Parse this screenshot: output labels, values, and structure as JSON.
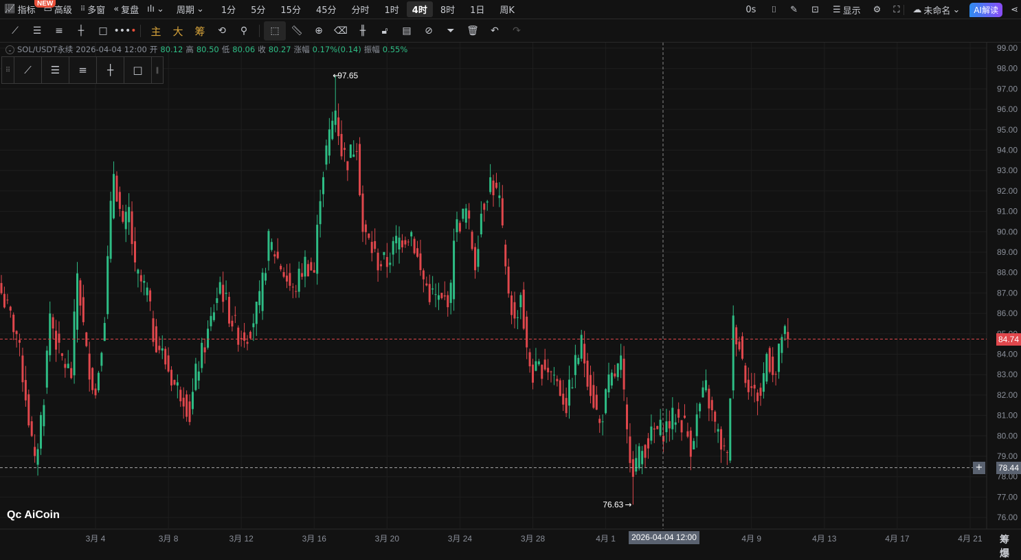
{
  "topbar": {
    "indicators": "指标",
    "new_badge": "NEW",
    "advanced": "高级",
    "multi_window": "多窗",
    "replay": "复盘",
    "period": "周期",
    "periods": [
      "1分",
      "5分",
      "15分",
      "45分",
      "分时",
      "1时",
      "4时",
      "8时",
      "1日",
      "周K"
    ],
    "active_period": "4时",
    "timer": "0s",
    "display": "显示",
    "layout_name": "未命名",
    "ai_button": "AI解读"
  },
  "toolbar": {
    "main": "主",
    "big": "大",
    "chip": "筹"
  },
  "info": {
    "symbol": "SOL/USDT永续",
    "datetime": "2026-04-04 12:00",
    "open_label": "开",
    "open": "80.12",
    "high_label": "高",
    "high": "80.50",
    "low_label": "低",
    "low": "80.06",
    "close_label": "收",
    "close": "80.27",
    "change_label": "涨幅",
    "change": "0.17%(0.14)",
    "amp_label": "振幅",
    "amp": "0.55%"
  },
  "logo": "AiCoin",
  "crosshair_time": "2026-04-04 12:00",
  "last_price": "84.74",
  "cursor_price": "78.44",
  "corner_label": "筹 爆",
  "colors": {
    "up": "#2ebd85",
    "down": "#e0474c",
    "bg": "#121212",
    "grid": "#1f1f1f"
  },
  "chart_data": {
    "type": "candlestick",
    "interval": "4h",
    "ylim": [
      75.5,
      99.2
    ],
    "y_ticks": [
      "99.00",
      "98.00",
      "97.00",
      "96.00",
      "95.00",
      "94.00",
      "93.00",
      "92.00",
      "91.00",
      "90.00",
      "89.00",
      "88.00",
      "87.00",
      "86.00",
      "85.00",
      "84.00",
      "83.00",
      "82.00",
      "81.00",
      "80.00",
      "79.00",
      "78.00",
      "77.00",
      "76.00"
    ],
    "x_ticks": [
      {
        "label": "3月 4",
        "candle": 31
      },
      {
        "label": "3月 8",
        "candle": 55
      },
      {
        "label": "3月 12",
        "candle": 79
      },
      {
        "label": "3月 16",
        "candle": 103
      },
      {
        "label": "3月 20",
        "candle": 127
      },
      {
        "label": "3月 24",
        "candle": 151
      },
      {
        "label": "3月 28",
        "candle": 175
      },
      {
        "label": "4月 1",
        "candle": 199
      },
      {
        "label": "4月 9",
        "candle": 247
      },
      {
        "label": "4月 13",
        "candle": 271
      },
      {
        "label": "4月 17",
        "candle": 295
      },
      {
        "label": "4月 21",
        "candle": 319
      }
    ],
    "max_marker": {
      "label": "97.65",
      "candle": 110,
      "value": 97.65
    },
    "min_marker": {
      "label": "76.63",
      "candle": 208,
      "value": 76.63
    },
    "close_anchors": [
      [
        0,
        87
      ],
      [
        5,
        85
      ],
      [
        8,
        82
      ],
      [
        11,
        78.5
      ],
      [
        14,
        82
      ],
      [
        16,
        86
      ],
      [
        19,
        84
      ],
      [
        23,
        83
      ],
      [
        25,
        88
      ],
      [
        28,
        84
      ],
      [
        31,
        82
      ],
      [
        34,
        86
      ],
      [
        36,
        91
      ],
      [
        37,
        93
      ],
      [
        40,
        90
      ],
      [
        42,
        91
      ],
      [
        44,
        88
      ],
      [
        48,
        87
      ],
      [
        50,
        85
      ],
      [
        53,
        84
      ],
      [
        57,
        82.5
      ],
      [
        60,
        82
      ],
      [
        62,
        81
      ],
      [
        64,
        83
      ],
      [
        68,
        85
      ],
      [
        72,
        87.5
      ],
      [
        75,
        86
      ],
      [
        78,
        85
      ],
      [
        81,
        85
      ],
      [
        85,
        86.5
      ],
      [
        88,
        89.5
      ],
      [
        90,
        89
      ],
      [
        93,
        88
      ],
      [
        96,
        87
      ],
      [
        100,
        88.5
      ],
      [
        103,
        88
      ],
      [
        105,
        92
      ],
      [
        107,
        94
      ],
      [
        110,
        96
      ],
      [
        112,
        94
      ],
      [
        114,
        93.5
      ],
      [
        117,
        94.5
      ],
      [
        119,
        90
      ],
      [
        121,
        89.5
      ],
      [
        124,
        88.5
      ],
      [
        127,
        88.5
      ],
      [
        130,
        89.5
      ],
      [
        135,
        90
      ],
      [
        138,
        88
      ],
      [
        141,
        87
      ],
      [
        145,
        86.5
      ],
      [
        148,
        87
      ],
      [
        149,
        90
      ],
      [
        153,
        91
      ],
      [
        156,
        88.5
      ],
      [
        158,
        91
      ],
      [
        161,
        92.5
      ],
      [
        164,
        91.5
      ],
      [
        166,
        88
      ],
      [
        169,
        85.5
      ],
      [
        171,
        87
      ],
      [
        173,
        84
      ],
      [
        175,
        83
      ],
      [
        179,
        83.5
      ],
      [
        182,
        83
      ],
      [
        186,
        81.5
      ],
      [
        189,
        83.5
      ],
      [
        191,
        84.5
      ],
      [
        193,
        83
      ],
      [
        197,
        80.5
      ],
      [
        200,
        82.5
      ],
      [
        204,
        83.5
      ],
      [
        206,
        80
      ],
      [
        208,
        78.5
      ],
      [
        212,
        79.5
      ],
      [
        215,
        80.2
      ],
      [
        218,
        80.3
      ],
      [
        222,
        81
      ],
      [
        225,
        80.5
      ],
      [
        227,
        79.5
      ],
      [
        230,
        81.5
      ],
      [
        232,
        82.3
      ],
      [
        234,
        81
      ],
      [
        236,
        80
      ],
      [
        239,
        78.8
      ],
      [
        241,
        85.5
      ],
      [
        243,
        84.5
      ],
      [
        245,
        83
      ],
      [
        248,
        82
      ],
      [
        250,
        82
      ],
      [
        252,
        84
      ],
      [
        255,
        83
      ],
      [
        257,
        85
      ],
      [
        259,
        84.74
      ]
    ]
  }
}
